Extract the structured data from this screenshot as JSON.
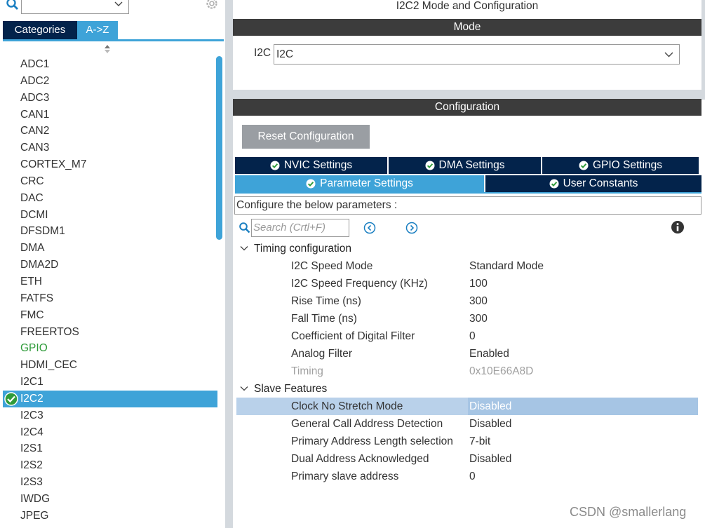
{
  "left": {
    "tabs": {
      "categories": "Categories",
      "az": "A->Z"
    },
    "peripherals": [
      {
        "label": "ADC1",
        "state": ""
      },
      {
        "label": "ADC2",
        "state": ""
      },
      {
        "label": "ADC3",
        "state": ""
      },
      {
        "label": "CAN1",
        "state": ""
      },
      {
        "label": "CAN2",
        "state": ""
      },
      {
        "label": "CAN3",
        "state": ""
      },
      {
        "label": "CORTEX_M7",
        "state": ""
      },
      {
        "label": "CRC",
        "state": ""
      },
      {
        "label": "DAC",
        "state": ""
      },
      {
        "label": "DCMI",
        "state": ""
      },
      {
        "label": "DFSDM1",
        "state": ""
      },
      {
        "label": "DMA",
        "state": ""
      },
      {
        "label": "DMA2D",
        "state": ""
      },
      {
        "label": "ETH",
        "state": ""
      },
      {
        "label": "FATFS",
        "state": ""
      },
      {
        "label": "FMC",
        "state": ""
      },
      {
        "label": "FREERTOS",
        "state": ""
      },
      {
        "label": "GPIO",
        "state": "ok"
      },
      {
        "label": "HDMI_CEC",
        "state": ""
      },
      {
        "label": "I2C1",
        "state": ""
      },
      {
        "label": "I2C2",
        "state": "selected"
      },
      {
        "label": "I2C3",
        "state": ""
      },
      {
        "label": "I2C4",
        "state": ""
      },
      {
        "label": "I2S1",
        "state": ""
      },
      {
        "label": "I2S2",
        "state": ""
      },
      {
        "label": "I2S3",
        "state": ""
      },
      {
        "label": "IWDG",
        "state": ""
      },
      {
        "label": "JPEG",
        "state": ""
      }
    ]
  },
  "right": {
    "title": "I2C2 Mode and Configuration",
    "mode_bar": "Mode",
    "mode_label": "I2C",
    "mode_value": "I2C",
    "config_bar": "Configuration",
    "reset_button": "Reset Configuration",
    "tabs_row1": [
      "NVIC Settings",
      "DMA Settings",
      "GPIO Settings"
    ],
    "tabs_row2": [
      "Parameter Settings",
      "User Constants"
    ],
    "description": "Configure the below parameters :",
    "search_placeholder": "Search (Crtl+F)",
    "groups": [
      {
        "name": "Timing configuration",
        "params": [
          {
            "name": "I2C Speed Mode",
            "value": "Standard Mode",
            "dim": false,
            "highlight": false
          },
          {
            "name": "I2C Speed Frequency (KHz)",
            "value": "100",
            "dim": false,
            "highlight": false
          },
          {
            "name": "Rise Time (ns)",
            "value": "300",
            "dim": false,
            "highlight": false
          },
          {
            "name": "Fall Time (ns)",
            "value": "300",
            "dim": false,
            "highlight": false
          },
          {
            "name": "Coefficient of Digital Filter",
            "value": "0",
            "dim": false,
            "highlight": false
          },
          {
            "name": "Analog Filter",
            "value": "Enabled",
            "dim": false,
            "highlight": false
          },
          {
            "name": "Timing",
            "value": "0x10E66A8D",
            "dim": true,
            "highlight": false
          }
        ]
      },
      {
        "name": "Slave Features",
        "params": [
          {
            "name": "Clock No Stretch Mode",
            "value": "Disabled",
            "dim": false,
            "highlight": true
          },
          {
            "name": "General Call Address Detection",
            "value": "Disabled",
            "dim": false,
            "highlight": false
          },
          {
            "name": "Primary Address Length selection",
            "value": "7-bit",
            "dim": false,
            "highlight": false
          },
          {
            "name": "Dual Address Acknowledged",
            "value": "Disabled",
            "dim": false,
            "highlight": false
          },
          {
            "name": "Primary slave address",
            "value": "0",
            "dim": false,
            "highlight": false
          }
        ]
      }
    ]
  },
  "watermark": "CSDN @smallerlang",
  "colors": {
    "accent": "#3ea3d8",
    "navy": "#03234b",
    "ok_green": "#2f9b3a"
  }
}
